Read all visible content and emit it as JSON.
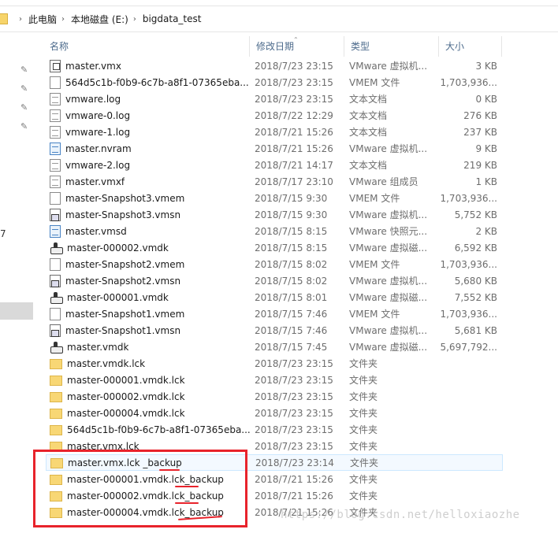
{
  "breadcrumb": [
    "此电脑",
    "本地磁盘 (E:)",
    "bigdata_test"
  ],
  "columns": {
    "name": "名称",
    "date": "修改日期",
    "type": "类型",
    "size": "大小"
  },
  "nav": {
    "partial_label": "7"
  },
  "files": [
    {
      "icon": "vmx-icon",
      "name": "master.vmx",
      "date": "2018/7/23 23:15",
      "type": "VMware 虚拟机...",
      "size": "3 KB"
    },
    {
      "icon": "file-icon",
      "name": "564d5c1b-f0b9-6c7b-a8f1-07365eba...",
      "date": "2018/7/23 23:15",
      "type": "VMEM 文件",
      "size": "1,703,936..."
    },
    {
      "icon": "text-file-icon",
      "name": "vmware.log",
      "date": "2018/7/23 23:15",
      "type": "文本文档",
      "size": "0 KB"
    },
    {
      "icon": "text-file-icon",
      "name": "vmware-0.log",
      "date": "2018/7/22 12:29",
      "type": "文本文档",
      "size": "276 KB"
    },
    {
      "icon": "text-file-icon",
      "name": "vmware-1.log",
      "date": "2018/7/21 15:26",
      "type": "文本文档",
      "size": "237 KB"
    },
    {
      "icon": "nvram-icon",
      "name": "master.nvram",
      "date": "2018/7/21 15:26",
      "type": "VMware 虚拟机...",
      "size": "9 KB"
    },
    {
      "icon": "text-file-icon",
      "name": "vmware-2.log",
      "date": "2018/7/21 14:17",
      "type": "文本文档",
      "size": "219 KB"
    },
    {
      "icon": "vmxf-icon",
      "name": "master.vmxf",
      "date": "2018/7/17 23:10",
      "type": "VMware 组成员",
      "size": "1 KB"
    },
    {
      "icon": "file-icon",
      "name": "master-Snapshot3.vmem",
      "date": "2018/7/15 9:30",
      "type": "VMEM 文件",
      "size": "1,703,936..."
    },
    {
      "icon": "vmsn-icon",
      "name": "master-Snapshot3.vmsn",
      "date": "2018/7/15 9:30",
      "type": "VMware 虚拟机...",
      "size": "5,752 KB"
    },
    {
      "icon": "vmsd-icon",
      "name": "master.vmsd",
      "date": "2018/7/15 8:15",
      "type": "VMware 快照元...",
      "size": "2 KB"
    },
    {
      "icon": "vmdk-icon",
      "name": "master-000002.vmdk",
      "date": "2018/7/15 8:15",
      "type": "VMware 虚拟磁...",
      "size": "6,592 KB"
    },
    {
      "icon": "file-icon",
      "name": "master-Snapshot2.vmem",
      "date": "2018/7/15 8:02",
      "type": "VMEM 文件",
      "size": "1,703,936..."
    },
    {
      "icon": "vmsn-icon",
      "name": "master-Snapshot2.vmsn",
      "date": "2018/7/15 8:02",
      "type": "VMware 虚拟机...",
      "size": "5,680 KB"
    },
    {
      "icon": "vmdk-icon",
      "name": "master-000001.vmdk",
      "date": "2018/7/15 8:01",
      "type": "VMware 虚拟磁...",
      "size": "7,552 KB"
    },
    {
      "icon": "file-icon",
      "name": "master-Snapshot1.vmem",
      "date": "2018/7/15 7:46",
      "type": "VMEM 文件",
      "size": "1,703,936..."
    },
    {
      "icon": "vmsn-icon",
      "name": "master-Snapshot1.vmsn",
      "date": "2018/7/15 7:46",
      "type": "VMware 虚拟机...",
      "size": "5,681 KB"
    },
    {
      "icon": "vmdk-icon",
      "name": "master.vmdk",
      "date": "2018/7/15 7:45",
      "type": "VMware 虚拟磁...",
      "size": "5,697,792..."
    },
    {
      "icon": "folder-icon",
      "name": "master.vmdk.lck",
      "date": "2018/7/23 23:15",
      "type": "文件夹",
      "size": ""
    },
    {
      "icon": "folder-icon",
      "name": "master-000001.vmdk.lck",
      "date": "2018/7/23 23:15",
      "type": "文件夹",
      "size": ""
    },
    {
      "icon": "folder-icon",
      "name": "master-000002.vmdk.lck",
      "date": "2018/7/23 23:15",
      "type": "文件夹",
      "size": ""
    },
    {
      "icon": "folder-icon",
      "name": "master-000004.vmdk.lck",
      "date": "2018/7/23 23:15",
      "type": "文件夹",
      "size": ""
    },
    {
      "icon": "folder-icon",
      "name": "564d5c1b-f0b9-6c7b-a8f1-07365eba...",
      "date": "2018/7/23 23:15",
      "type": "文件夹",
      "size": ""
    },
    {
      "icon": "folder-icon",
      "name": "master.vmx.lck",
      "date": "2018/7/23 23:15",
      "type": "文件夹",
      "size": ""
    },
    {
      "icon": "folder-icon",
      "name": "master.vmx.lck _backup",
      "date": "2018/7/23 23:14",
      "type": "文件夹",
      "size": "",
      "selected": true
    },
    {
      "icon": "folder-icon",
      "name": "master-000001.vmdk.lck_backup",
      "date": "2018/7/21 15:26",
      "type": "文件夹",
      "size": ""
    },
    {
      "icon": "folder-icon",
      "name": "master-000002.vmdk.lck_backup",
      "date": "2018/7/21 15:26",
      "type": "文件夹",
      "size": ""
    },
    {
      "icon": "folder-icon",
      "name": "master-000004.vmdk.lck_backup",
      "date": "2018/7/21 15:26",
      "type": "文件夹",
      "size": ""
    }
  ],
  "annotation_color": "#e8232b",
  "watermark": "https://blog.csdn.net/helloxiaozhe"
}
